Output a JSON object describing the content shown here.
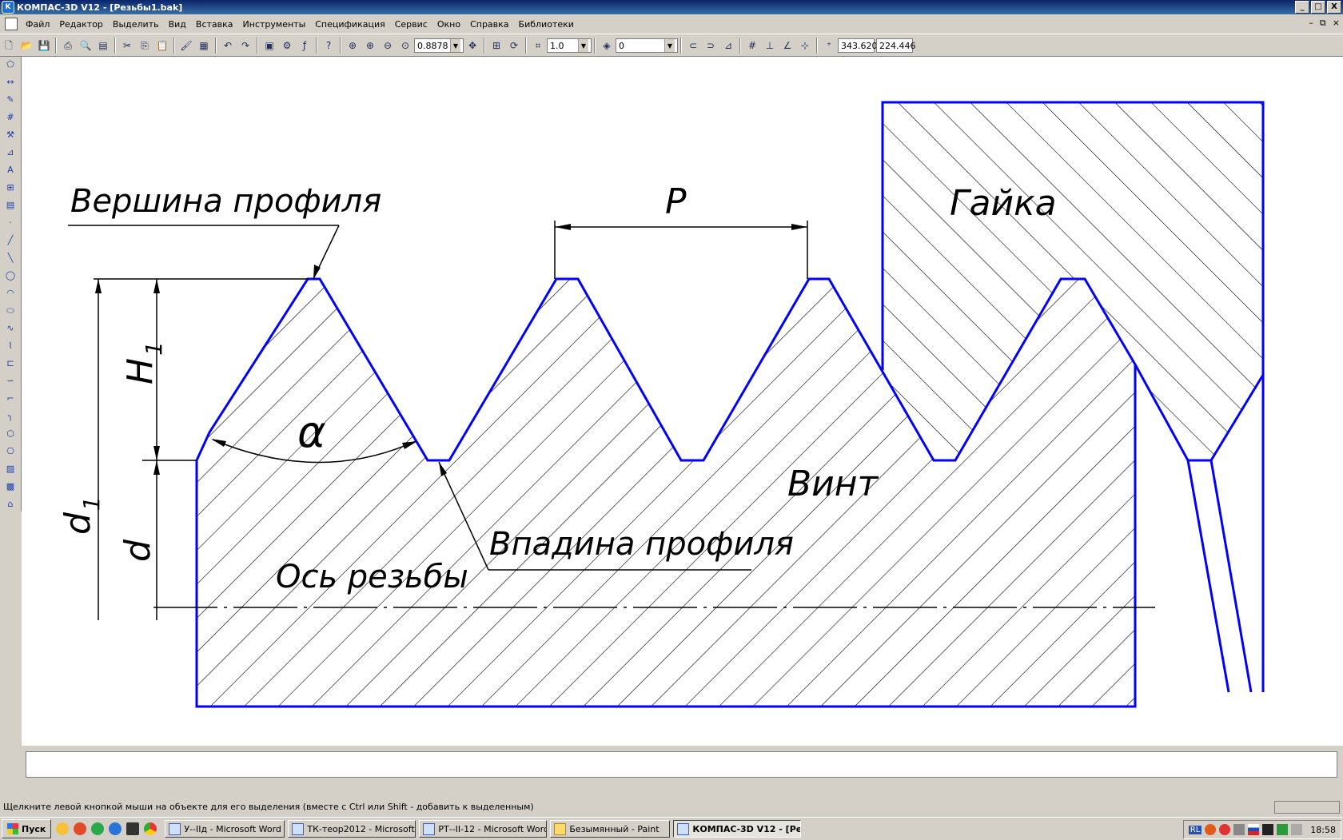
{
  "window": {
    "title": "КОМПАС-3D V12 - [Резьбы1.bak]",
    "controls": {
      "minimize": "_",
      "maximize": "□",
      "close": "X"
    }
  },
  "menu": {
    "items": [
      "Файл",
      "Редактор",
      "Выделить",
      "Вид",
      "Вставка",
      "Инструменты",
      "Спецификация",
      "Сервис",
      "Окно",
      "Справка",
      "Библиотеки"
    ],
    "mdi_controls": [
      "–",
      "⧉",
      "×"
    ]
  },
  "toolbar": {
    "zoom": "0.8878",
    "step": "1.0",
    "layer": "0",
    "coord_x": "343.620",
    "coord_y": "224.446"
  },
  "drawing": {
    "label_crest": "Вершина профиля",
    "label_pitch": "P",
    "label_nut": "Гайка",
    "label_height": "H",
    "label_height_sub": "1",
    "label_angle": "α",
    "label_screw": "Винт",
    "label_d1": "d",
    "label_d1_sub": "1",
    "label_d": "d",
    "label_root": "Впадина профиля",
    "label_axis": "Ось резьбы",
    "outline_color": "#0000ff",
    "line_color": "#000000"
  },
  "status": {
    "hint": "Щелкните левой кнопкой мыши на объекте для его выделения (вместе с Ctrl или Shift - добавить к выделенным)"
  },
  "taskbar": {
    "start": "Пуск",
    "tasks": [
      "У--IIд - Microsoft Word",
      "ТК-теор2012 - Microsoft...",
      "РТ--II-12 - Microsoft Word",
      "Безымянный - Paint",
      "КОМПАС-3D V12 - [Ре..."
    ],
    "lang": "RL",
    "clock": "18:58"
  }
}
